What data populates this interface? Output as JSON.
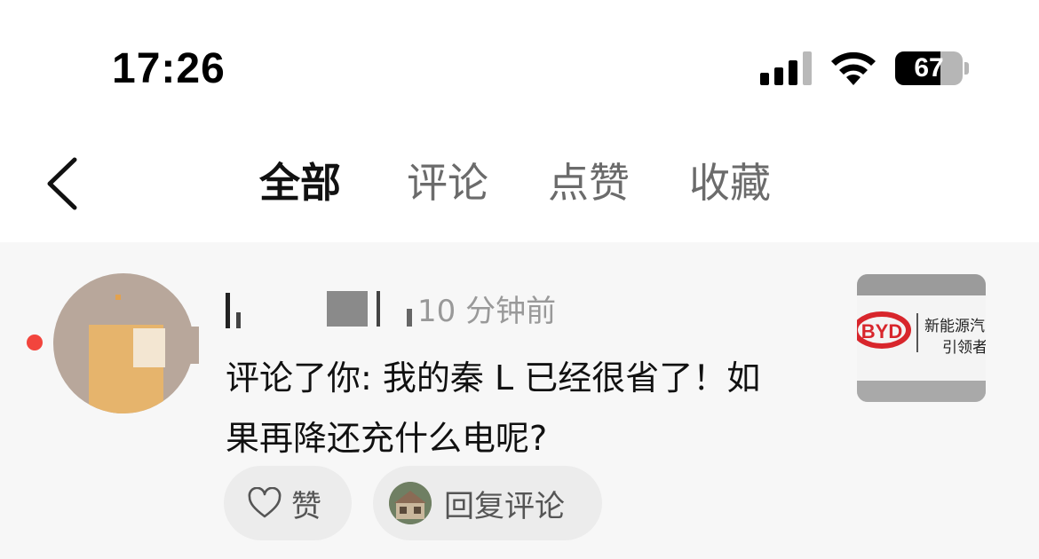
{
  "status_bar": {
    "time": "17:26",
    "battery_percent": "67",
    "battery_level": 0.67,
    "signal_bars": 3
  },
  "nav": {
    "back_icon": "chevron-left-icon",
    "tabs": [
      {
        "label": "全部",
        "active": true
      },
      {
        "label": "评论",
        "active": false
      },
      {
        "label": "点赞",
        "active": false
      },
      {
        "label": "收藏",
        "active": false
      }
    ]
  },
  "notification": {
    "unread": true,
    "unread_color": "#f2453d",
    "timestamp": "10 分钟前",
    "message_line1": "评论了你: 我的秦 L 已经很省了！如",
    "message_line2": "果再降还充什么电呢?",
    "thumbnail_brand": "BYD",
    "thumbnail_caption_line1": "新能源汽",
    "thumbnail_caption_line2": "引领者",
    "like_label": "赞",
    "reply_label": "回复评论"
  }
}
